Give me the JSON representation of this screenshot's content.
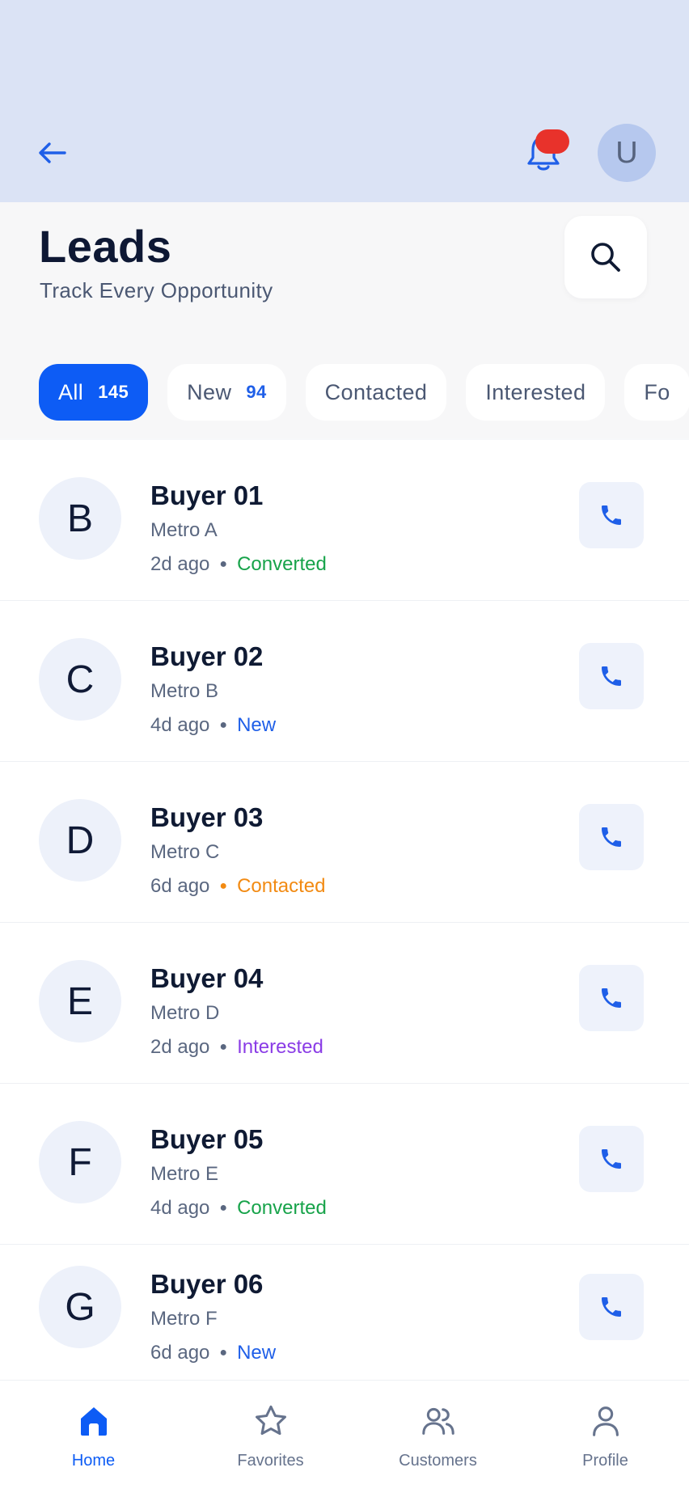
{
  "header": {
    "title": "Leads",
    "subtitle": "Track Every Opportunity",
    "avatar_initial": "U",
    "back_icon": "arrow-left-icon",
    "notification_icon": "bell-icon",
    "search_icon": "search-icon"
  },
  "tabs": [
    {
      "label": "All",
      "count": "145",
      "active": true
    },
    {
      "label": "New",
      "count": "94",
      "active": false
    },
    {
      "label": "Contacted",
      "count": "",
      "active": false
    },
    {
      "label": "Interested",
      "count": "",
      "active": false
    },
    {
      "label": "Fo",
      "count": "",
      "active": false
    }
  ],
  "status_colors": {
    "Converted": "#17a34a",
    "New": "#1f5fe8",
    "Contacted": "#f28a12",
    "Interested": "#8a3ce6"
  },
  "leads": [
    {
      "initial": "B",
      "name": "Buyer 01",
      "location": "Metro A",
      "time": "2d ago",
      "status": "Converted"
    },
    {
      "initial": "C",
      "name": "Buyer 02",
      "location": "Metro B",
      "time": "4d ago",
      "status": "New"
    },
    {
      "initial": "D",
      "name": "Buyer 03",
      "location": "Metro C",
      "time": "6d ago",
      "status": "Contacted"
    },
    {
      "initial": "E",
      "name": "Buyer 04",
      "location": "Metro D",
      "time": "2d ago",
      "status": "Interested"
    },
    {
      "initial": "F",
      "name": "Buyer 05",
      "location": "Metro E",
      "time": "4d ago",
      "status": "Converted"
    },
    {
      "initial": "G",
      "name": "Buyer 06",
      "location": "Metro F",
      "time": "6d ago",
      "status": "New"
    }
  ],
  "bottom_nav": [
    {
      "label": "Home",
      "icon": "home-icon",
      "active": true
    },
    {
      "label": "Favorites",
      "icon": "star-icon",
      "active": false
    },
    {
      "label": "Customers",
      "icon": "users-icon",
      "active": false
    },
    {
      "label": "Profile",
      "icon": "user-icon",
      "active": false
    }
  ]
}
